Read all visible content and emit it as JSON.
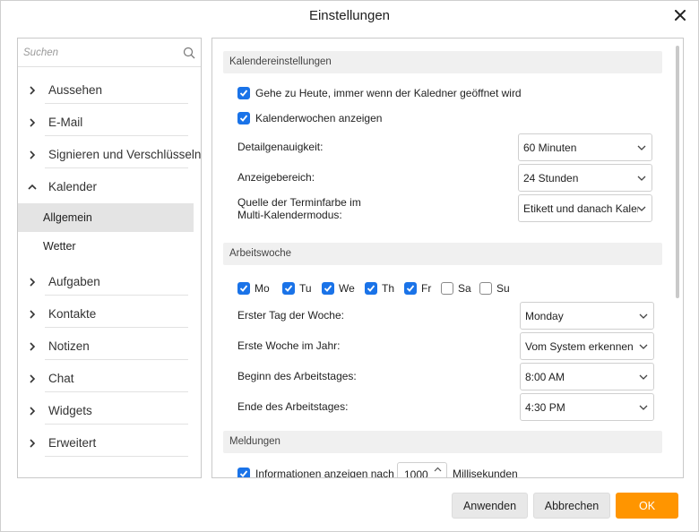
{
  "window": {
    "title": "Einstellungen"
  },
  "sidebar": {
    "search_placeholder": "Suchen",
    "items": [
      {
        "label": "Aussehen",
        "expanded": false
      },
      {
        "label": "E-Mail",
        "expanded": false
      },
      {
        "label": "Signieren und Verschlüsseln",
        "expanded": false
      },
      {
        "label": "Kalender",
        "expanded": true,
        "children": [
          {
            "label": "Allgemein",
            "selected": true
          },
          {
            "label": "Wetter",
            "selected": false
          }
        ]
      },
      {
        "label": "Aufgaben",
        "expanded": false
      },
      {
        "label": "Kontakte",
        "expanded": false
      },
      {
        "label": "Notizen",
        "expanded": false
      },
      {
        "label": "Chat",
        "expanded": false
      },
      {
        "label": "Widgets",
        "expanded": false
      },
      {
        "label": "Erweitert",
        "expanded": false
      }
    ]
  },
  "calendar_settings": {
    "header": "Kalendereinstellungen",
    "goto_today": {
      "label": "Gehe zu Heute, immer wenn der Kaledner geöffnet wird",
      "checked": true
    },
    "show_weeks": {
      "label": "Kalenderwochen anzeigen",
      "checked": true
    },
    "detail": {
      "label": "Detailgenauigkeit:",
      "value": "60 Minuten"
    },
    "range": {
      "label": "Anzeigebereich:",
      "value": "24 Stunden"
    },
    "color_source": {
      "label_line1": "Quelle der Terminfarbe im",
      "label_line2": "Multi-Kalendermodus:",
      "value": "Etikett und danach Kalender"
    }
  },
  "work_week": {
    "header": "Arbeitswoche",
    "days": [
      {
        "label": "Mo",
        "checked": true
      },
      {
        "label": "Tu",
        "checked": true
      },
      {
        "label": "We",
        "checked": true
      },
      {
        "label": "Th",
        "checked": true
      },
      {
        "label": "Fr",
        "checked": true
      },
      {
        "label": "Sa",
        "checked": false
      },
      {
        "label": "Su",
        "checked": false
      }
    ],
    "first_day": {
      "label": "Erster Tag der Woche:",
      "value": "Monday"
    },
    "first_week": {
      "label": "Erste Woche im Jahr:",
      "value": "Vom System erkennen"
    },
    "start": {
      "label": "Beginn des Arbeitstages:",
      "value": "8:00 AM"
    },
    "end": {
      "label": "Ende des Arbeitstages:",
      "value": "4:30 PM"
    }
  },
  "notifications": {
    "header": "Meldungen",
    "info": {
      "label": "Informationen anzeigen nach",
      "checked": true,
      "value": "1000",
      "unit": "Millisekunden"
    }
  },
  "buttons": {
    "apply": "Anwenden",
    "cancel": "Abbrechen",
    "ok": "OK"
  },
  "colors": {
    "accent": "#1a73e8",
    "primary_button": "#ff9500",
    "selected_item": "#e4e4e4"
  }
}
